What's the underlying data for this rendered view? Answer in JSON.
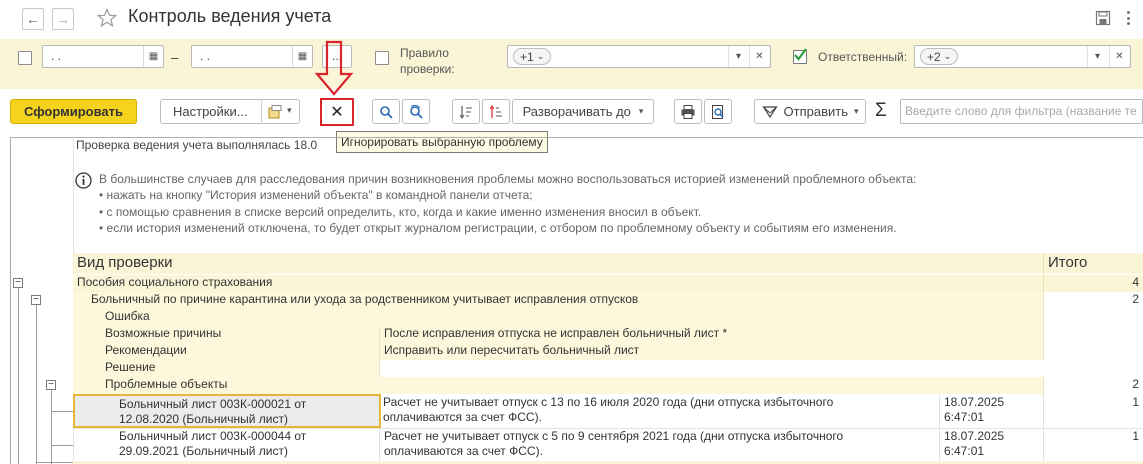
{
  "title": "Контроль ведения учета",
  "filter": {
    "date_from": " .  .",
    "date_to": " .  .",
    "dash": "–",
    "ellipsis": "...",
    "rule_label_line1": "Правило",
    "rule_label_line2": "проверки:",
    "rule_value": "+1",
    "responsible_label": "Ответственный:",
    "responsible_value": "+2",
    "responsible_checked": true,
    "rule_checked": false,
    "period_checked": false
  },
  "toolbar": {
    "generate": "Сформировать",
    "settings": "Настройки...",
    "ignore": "✕",
    "expand": "Разворачивать до",
    "send": "Отправить",
    "sigma": "Σ",
    "filter_placeholder": "Введите слово для фильтра (название те"
  },
  "tooltip": "Игнорировать выбранную проблему",
  "report": {
    "check_date": "Проверка ведения учета выполнялась 18.0",
    "info_line1": "В большинстве случаев для расследования причин возникновения проблемы можно воспользоваться историей изменений проблемного объекта:",
    "info_line2": "• нажать на кнопку \"История изменений объекта\" в командной панели отчета;",
    "info_line3": "• с помощью сравнения в списке версий определить, кто, когда и какие именно изменения вносил в объект.",
    "info_line4": "• если история изменений отключена, то будет открыт журналом регистрации, с отбором по проблемному объекту и событиям его изменения.",
    "header_check_type": "Вид проверки",
    "header_total": "Итого",
    "group1": "Пособия социального страхования",
    "group1_total": "4",
    "group2": "Больничный по причине карантина или ухода за родственником учитывает исправления отпусков",
    "group2_total": "2",
    "error_label": "Ошибка",
    "causes_label": "Возможные причины",
    "causes_value": "После исправления отпуска не исправлен больничный лист *",
    "recommend_label": "Рекомендации",
    "recommend_value": "Исправить или пересчитать больничный лист",
    "solution_label": "Решение",
    "objects_label": "Проблемные объекты",
    "objects_total": "2",
    "items": [
      {
        "object_line1": "Больничный лист 003К-000021 от",
        "object_line2": "12.08.2020 (Больничный лист)",
        "desc_line1": "Расчет не учитывает отпуск с 13 по 16 июля 2020 года (дни отпуска избыточного",
        "desc_line2": "оплачиваются за счет ФСС).",
        "date_line1": "18.07.2025",
        "date_line2": "6:47:01",
        "total": "1"
      },
      {
        "object_line1": "Больничный лист 003К-000044 от",
        "object_line2": "29.09.2021 (Больничный лист)",
        "desc_line1": "Расчет не учитывает отпуск с 5 по 9 сентября 2021 года (дни отпуска избыточного",
        "desc_line2": "оплачиваются за счет ФСС).",
        "date_line1": "18.07.2025",
        "date_line2": "6:47:01",
        "total": "1"
      }
    ]
  },
  "colors": {
    "panel_bg": "#fbf5d7",
    "primary_button": "#f5d31c",
    "highlight_red": "#d9262c",
    "selection_border": "#e8b43a"
  }
}
